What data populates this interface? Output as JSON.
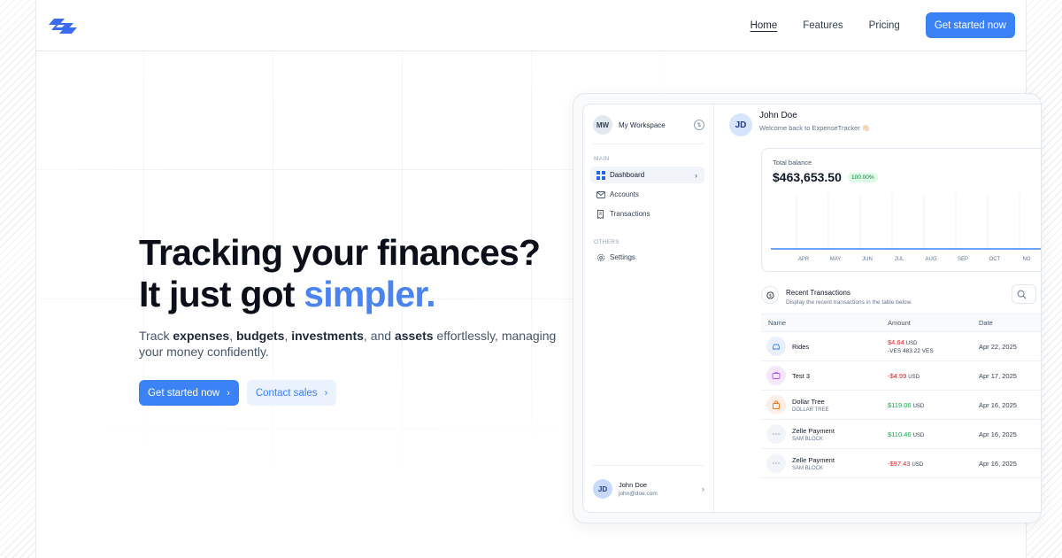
{
  "colors": {
    "accent": "#3b82f6",
    "headline_accent": "#4a84f0",
    "positive": "#16a34a",
    "negative": "#dc2626",
    "chart_line": "#3b82f6"
  },
  "header": {
    "logo": "brand-logo-icon",
    "nav": [
      {
        "label": "Home",
        "active": true
      },
      {
        "label": "Features",
        "active": false
      },
      {
        "label": "Pricing",
        "active": false
      }
    ],
    "cta_label": "Get started now"
  },
  "hero": {
    "headline_line1": "Tracking your finances?",
    "headline_line2_prefix": "It just got ",
    "headline_line2_accent": "simpler.",
    "sub_parts": {
      "p0": "Track ",
      "b1": "expenses",
      "p1": ", ",
      "b2": "budgets",
      "p2": ", ",
      "b3": "investments",
      "p3": ", and ",
      "b4": "assets",
      "p4": " effortlessly, managing your money confidently."
    },
    "primary_cta": "Get started now",
    "secondary_cta": "Contact sales"
  },
  "app": {
    "workspace": {
      "initials": "MW",
      "name": "My Workspace"
    },
    "sections": {
      "main": "MAIN",
      "others": "OTHERS"
    },
    "nav_main": [
      {
        "label": "Dashboard",
        "icon": "dashboard-icon",
        "active": true
      },
      {
        "label": "Accounts",
        "icon": "mail-icon",
        "active": false
      },
      {
        "label": "Transactions",
        "icon": "receipt-icon",
        "active": false
      }
    ],
    "nav_others": [
      {
        "label": "Settings",
        "icon": "gear-icon"
      }
    ],
    "sidebar_user": {
      "initials": "JD",
      "name": "John Doe",
      "email": "john@doe.com"
    },
    "user": {
      "initials": "JD",
      "name": "John Doe",
      "welcome": "Welcome back to ExpenseTracker 👋🏻"
    },
    "balance": {
      "label": "Total balance",
      "amount": "$463,653.50",
      "change": "100.00%"
    },
    "transactions": {
      "title": "Recent Transactions",
      "subtitle": "Display the recent transactions in the table below.",
      "columns": {
        "name": "Name",
        "amount": "Amount",
        "date": "Date"
      },
      "rows": [
        {
          "name": "Rides",
          "sub": "",
          "amount": "$4.64",
          "currency": "USD",
          "secondary": "-VES 483.22 VES",
          "sign": "negative",
          "date": "Apr 22, 2025",
          "icon": "car-icon",
          "icon_bg": "#e8f0fe",
          "icon_color": "#3b82f6"
        },
        {
          "name": "Test 3",
          "sub": "",
          "amount": "-$4.99",
          "currency": "USD",
          "secondary": "",
          "sign": "negative",
          "date": "Apr 17, 2025",
          "icon": "tv-icon",
          "icon_bg": "#f5e8fd",
          "icon_color": "#a855f7"
        },
        {
          "name": "Dollar Tree",
          "sub": "DOLLAR TREE",
          "amount": "$119.06",
          "currency": "USD",
          "secondary": "",
          "sign": "positive",
          "date": "Apr 16, 2025",
          "icon": "shopping-bag-icon",
          "icon_bg": "#fdeee6",
          "icon_color": "#f97316"
        },
        {
          "name": "Zelle Payment",
          "sub": "SAM BLOCK",
          "amount": "$110.46",
          "currency": "USD",
          "secondary": "",
          "sign": "positive",
          "date": "Apr 16, 2025",
          "icon": "more-dots-icon",
          "icon_bg": "#f1f5f9",
          "icon_color": "#94a3b8"
        },
        {
          "name": "Zelle Payment",
          "sub": "SAM BLOCK",
          "amount": "-$97.43",
          "currency": "USD",
          "secondary": "",
          "sign": "negative",
          "date": "Apr 16, 2025",
          "icon": "more-dots-icon",
          "icon_bg": "#f1f5f9",
          "icon_color": "#94a3b8"
        }
      ]
    }
  },
  "chart_data": {
    "type": "line",
    "categories": [
      "APR",
      "MAY",
      "JUN",
      "JUL",
      "AUG",
      "SEP",
      "OCT",
      "NO"
    ],
    "series": [
      {
        "values": [
          0,
          0,
          0,
          0,
          0,
          0,
          0,
          0
        ]
      }
    ],
    "grid": true
  }
}
